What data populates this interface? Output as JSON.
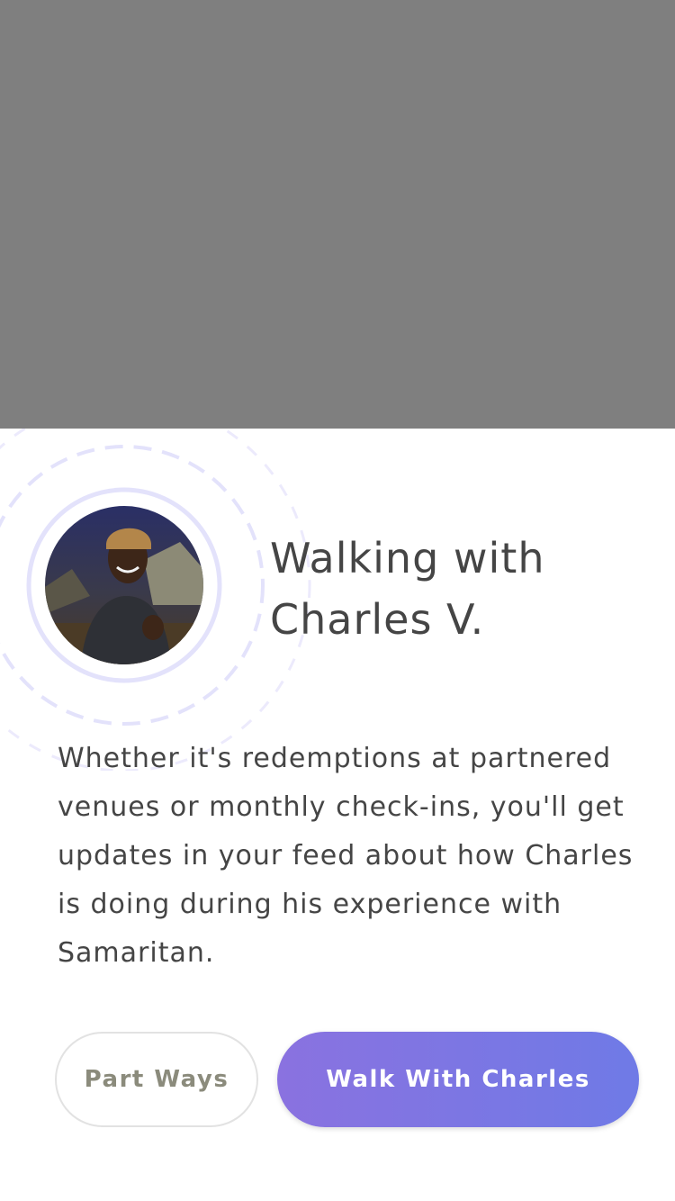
{
  "title": "Walking with Charles V.",
  "description": "Whether it's redemptions at partnered venues or monthly check-ins, you'll get updates in your feed about how Charles is doing during his experience with Samaritan.",
  "buttons": {
    "secondary_label": "Part Ways",
    "primary_label": "Walk With Charles"
  },
  "colors": {
    "overlay": "#7f7f7f",
    "primary_gradient_start": "#8a72e0",
    "primary_gradient_end": "#6f7ae6",
    "text": "#454545",
    "ring": "#e3e2fb"
  },
  "icons": {
    "avatar": "profile-photo"
  }
}
